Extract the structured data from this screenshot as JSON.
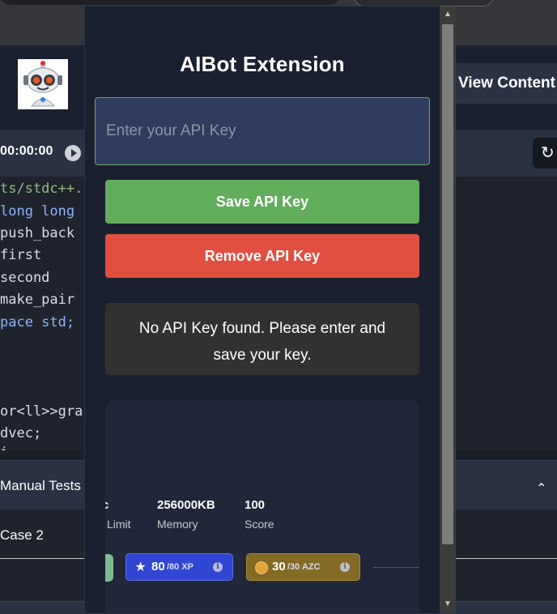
{
  "background_page": {
    "view_content_label": "View Content",
    "timer": "00:00:00",
    "refresh_icon": "↻",
    "code_lines": [
      "ts/stdc++.",
      "long long",
      "push_back",
      "first",
      "second",
      "make_pair",
      "pace std;",
      "",
      "",
      "or<ll>>gra",
      "dvec;",
      "i"
    ],
    "manual_tests_label": "Manual Tests",
    "case_label": "Case 2",
    "chevron": "⌃"
  },
  "popup": {
    "title": "AIBot Extension",
    "api_key_placeholder": "Enter your API Key",
    "api_key_value": "",
    "save_label": "Save API Key",
    "remove_label": "Remove API Key",
    "status_message": "No API Key found. Please enter and save your key."
  },
  "card": {
    "stats": [
      {
        "value": "c",
        "label": "Limit"
      },
      {
        "value": "256000KB",
        "label": "Memory"
      },
      {
        "value": "100",
        "label": "Score"
      }
    ],
    "xp": {
      "value": "80",
      "max": "/80 XP",
      "icon": "★",
      "info": "i"
    },
    "azc": {
      "value": "30",
      "max": "/30 AZC",
      "info": "i"
    }
  },
  "icons": {
    "scroll_up": "▲",
    "scroll_down": "▼"
  },
  "colors": {
    "save": "#62ad5c",
    "remove": "#e14f41",
    "xp_badge": "#2f47d2",
    "azc_badge": "#856a26"
  }
}
